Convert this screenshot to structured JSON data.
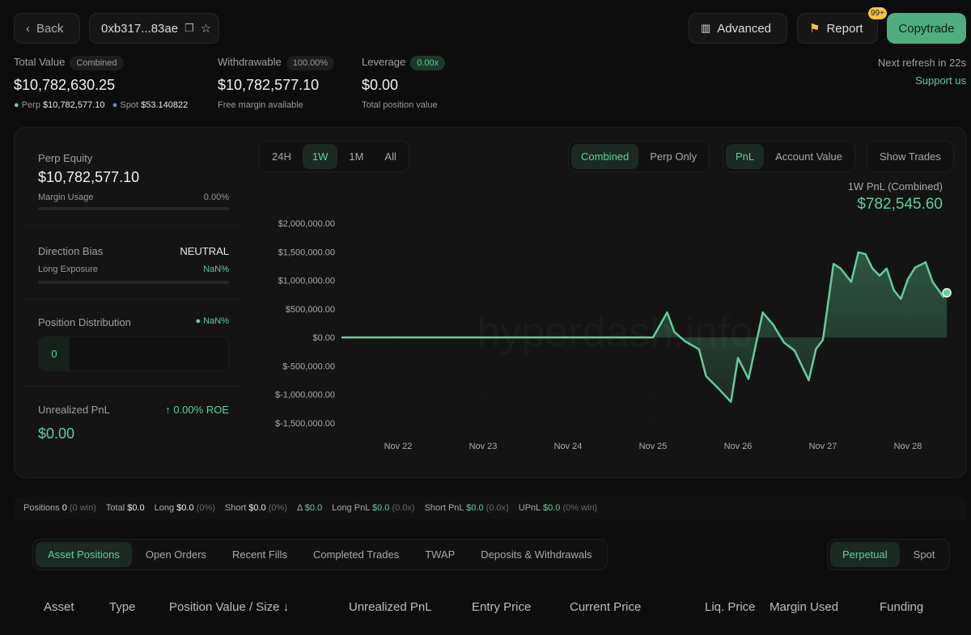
{
  "header": {
    "back_label": "Back",
    "address": "0xb317...83ae",
    "advanced_label": "Advanced",
    "report_label": "Report",
    "report_badge": "99+",
    "copytrade_label": "Copytrade",
    "refresh_text": "Next refresh in 22s",
    "support_label": "Support us",
    "accent": "#5fcf9a"
  },
  "summary": {
    "total_value": {
      "label": "Total Value",
      "badge": "Combined",
      "value": "$10,782,630.25",
      "perp_label": "Perp",
      "perp_value": "$10,782,577.10",
      "spot_label": "Spot",
      "spot_value": "$53.140822"
    },
    "withdrawable": {
      "label": "Withdrawable",
      "badge": "100.00%",
      "value": "$10,782,577.10",
      "sub": "Free margin available"
    },
    "leverage": {
      "label": "Leverage",
      "badge": "0.00x",
      "value": "$0.00",
      "sub": "Total position value"
    }
  },
  "left_panel": {
    "perp_equity_label": "Perp Equity",
    "perp_equity": "$10,782,577.10",
    "margin_usage_label": "Margin Usage",
    "margin_usage": "0.00%",
    "direction_bias_label": "Direction Bias",
    "direction_bias": "NEUTRAL",
    "long_exposure_label": "Long Exposure",
    "long_exposure": "NaN%",
    "position_distribution_label": "Position Distribution",
    "position_distribution": "NaN%",
    "distribution_count": "0",
    "upnl_label": "Unrealized PnL",
    "roe": "0.00% ROE",
    "upnl": "$0.00"
  },
  "chart_controls": {
    "ranges": [
      "24H",
      "1W",
      "1M",
      "All"
    ],
    "active_range": "1W",
    "scopes": [
      "Combined",
      "Perp Only"
    ],
    "active_scope": "Combined",
    "metrics": [
      "PnL",
      "Account Value"
    ],
    "active_metric": "PnL",
    "show_trades": "Show Trades",
    "pnl_title": "1W PnL (Combined)",
    "pnl_value": "$782,545.60"
  },
  "watermark": "hyperdash.info",
  "chart_data": {
    "type": "area",
    "grid": true,
    "legend": "none",
    "ylim": [
      -1500000,
      2000000
    ],
    "yticks": [
      "$2,000,000.00",
      "$1,500,000.00",
      "$1,000,000.00",
      "$500,000.00",
      "$0.00",
      "$-500,000.00",
      "$-1,000,000.00",
      "$-1,500,000.00"
    ],
    "ytick_values": [
      2000000,
      1500000,
      1000000,
      500000,
      0,
      -500000,
      -1000000,
      -1500000
    ],
    "xticks": [
      "Nov 22",
      "Nov 23",
      "Nov 24",
      "Nov 25",
      "Nov 26",
      "Nov 27",
      "Nov 28"
    ],
    "x": [
      "Nov 21 08:00",
      "Nov 25 00:00",
      "Nov 25 04:00",
      "Nov 25 06:00",
      "Nov 25 09:00",
      "Nov 25 13:00",
      "Nov 25 15:00",
      "Nov 25 18:00",
      "Nov 25 22:00",
      "Nov 26 00:00",
      "Nov 26 03:00",
      "Nov 26 07:00",
      "Nov 26 10:00",
      "Nov 26 13:00",
      "Nov 26 16:00",
      "Nov 26 20:00",
      "Nov 26 22:00",
      "Nov 27 00:00",
      "Nov 27 03:00",
      "Nov 27 05:00",
      "Nov 27 08:00",
      "Nov 27 10:00",
      "Nov 27 12:00",
      "Nov 27 14:00",
      "Nov 27 16:00",
      "Nov 27 18:00",
      "Nov 27 20:00",
      "Nov 27 22:00",
      "Nov 28 00:00",
      "Nov 28 02:00",
      "Nov 28 05:00",
      "Nov 28 07:00",
      "Nov 28 10:00",
      "Nov 28 11:00"
    ],
    "values": [
      0,
      0,
      439000,
      99000,
      -66000,
      -208000,
      -680000,
      -864000,
      -1129000,
      -359000,
      -727000,
      439000,
      217000,
      -90000,
      -231000,
      -751000,
      -208000,
      -42000,
      1289000,
      1208000,
      973000,
      1491000,
      1459000,
      1208000,
      1081000,
      1208000,
      831000,
      675000,
      1020000,
      1222000,
      1317000,
      973000,
      712000,
      782546
    ],
    "color": "#5fcf9a"
  },
  "stats_bar": {
    "items": [
      {
        "label": "Positions",
        "value": "0",
        "extra": "(0 win)",
        "green": false
      },
      {
        "label": "Total",
        "value": "$0.0",
        "extra": "",
        "green": false
      },
      {
        "label": "Long",
        "value": "$0.0",
        "extra": "(0%)",
        "green": false
      },
      {
        "label": "Short",
        "value": "$0.0",
        "extra": "(0%)",
        "green": false
      },
      {
        "label": "Δ",
        "value": "$0.0",
        "extra": "",
        "green": true
      },
      {
        "label": "Long PnL",
        "value": "$0.0",
        "extra": "(0.0x)",
        "green": true
      },
      {
        "label": "Short PnL",
        "value": "$0.0",
        "extra": "(0.0x)",
        "green": true
      },
      {
        "label": "UPnL",
        "value": "$0.0",
        "extra": "(0% win)",
        "green": true
      }
    ]
  },
  "tabs": {
    "items": [
      "Asset Positions",
      "Open Orders",
      "Recent Fills",
      "Completed Trades",
      "TWAP",
      "Deposits & Withdrawals"
    ],
    "active": "Asset Positions",
    "market": [
      "Perpetual",
      "Spot"
    ],
    "active_market": "Perpetual"
  },
  "table": {
    "columns": [
      "Asset",
      "Type",
      "Position Value / Size ↓",
      "Unrealized PnL",
      "Entry Price",
      "Current Price",
      "Liq. Price",
      "Margin Used",
      "Funding"
    ]
  }
}
